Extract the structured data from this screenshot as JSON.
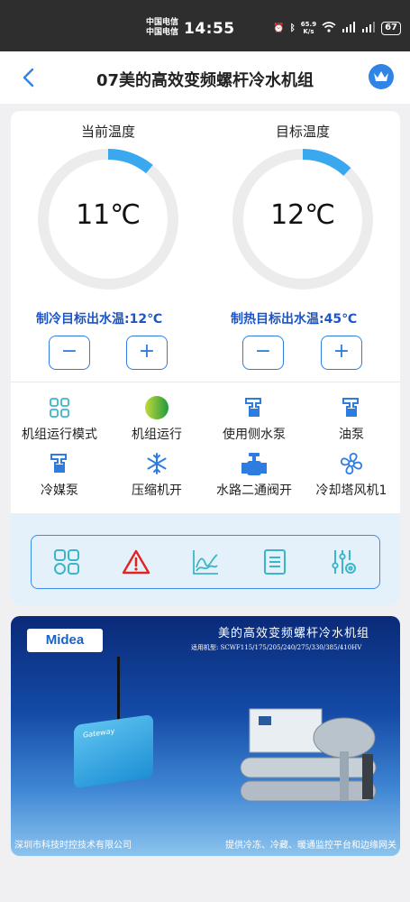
{
  "status_bar": {
    "carrier1": "中国电信",
    "carrier2": "中国电信",
    "time": "14:55",
    "net_speed_value": "65.9",
    "net_speed_unit": "K/s",
    "battery": "67"
  },
  "header": {
    "title": "07美的高效变频螺杆冷水机组"
  },
  "gauges": {
    "current": {
      "label": "当前温度",
      "value": "11℃",
      "fill": 0.11
    },
    "target": {
      "label": "目标温度",
      "value": "12℃",
      "fill": 0.12
    }
  },
  "setpoints": {
    "cooling": "制冷目标出水温:12℃",
    "heating": "制热目标出水温:45℃"
  },
  "stepper": {
    "minus": "−",
    "plus": "+"
  },
  "status_items": [
    {
      "label": "机组运行模式",
      "icon": "grid-icon"
    },
    {
      "label": "机组运行",
      "icon": "status-dot-icon"
    },
    {
      "label": "使用侧水泵",
      "icon": "pump-icon"
    },
    {
      "label": "油泵",
      "icon": "pump-icon"
    },
    {
      "label": "冷媒泵",
      "icon": "pump-icon"
    },
    {
      "label": "压缩机开",
      "icon": "snowflake-icon"
    },
    {
      "label": "水路二通阀开",
      "icon": "valve-icon"
    },
    {
      "label": "冷却塔风机1",
      "icon": "fan-icon"
    }
  ],
  "toolbar": [
    "grid-icon",
    "alarm-icon",
    "chart-icon",
    "list-icon",
    "settings-icon"
  ],
  "banner": {
    "logo": "Midea",
    "title": "美的高效变频螺杆冷水机组",
    "models": "适用机型: SCWF115/175/205/240/275/330/385/410HV",
    "footer_left": "深圳市科技时控技术有限公司",
    "footer_right": "提供冷冻、冷藏、暖通监控平台和边缘网关",
    "gateway_label": "Gateway"
  },
  "colors": {
    "accent": "#2f84e6",
    "gauge_arc": "#3aa8ee",
    "setpoint_text": "#1a55c9",
    "toolbar_bg": "#e4f1fb",
    "alarm": "#e02424",
    "running": "#3bb54a"
  }
}
